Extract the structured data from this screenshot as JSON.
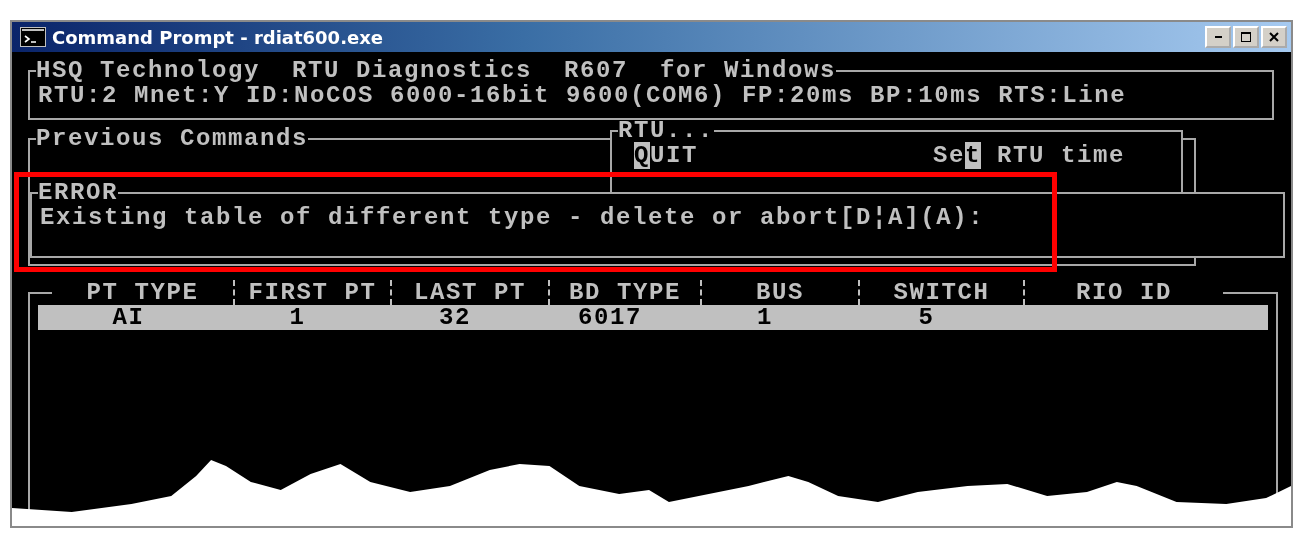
{
  "window": {
    "title": "Command Prompt - rdiat600.exe"
  },
  "header": {
    "title": "HSQ Technology  RTU Diagnostics  R607  for Windows",
    "status": "RTU:2 Mnet:Y ID:NoCOS 6000-16bit 9600(COM6) FP:20ms BP:10ms RTS:Line"
  },
  "previous_commands": {
    "title": "Previous Commands"
  },
  "rtu_menu": {
    "title": "RTU...",
    "items": [
      {
        "hotkey": "Q",
        "after": "UIT"
      },
      {
        "before": "Se",
        "hotkey": "t",
        "after": " RTU time"
      }
    ]
  },
  "error": {
    "title": "ERROR",
    "message": "Existing table of different type - delete or abort[D¦A](A):"
  },
  "table": {
    "columns": [
      "PT TYPE",
      "FIRST PT",
      "LAST PT",
      "BD TYPE",
      "BUS",
      "SWITCH",
      "RIO ID"
    ],
    "rows": [
      {
        "cells": [
          "AI",
          "1",
          "32",
          "6017",
          "1",
          "5"
        ],
        "selected": true
      }
    ]
  }
}
